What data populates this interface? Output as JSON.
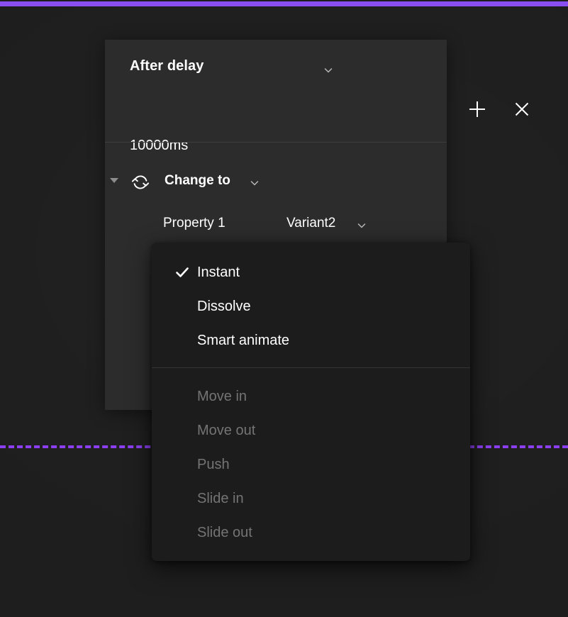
{
  "canvas": {
    "background_color": "#1e1e1e",
    "accent_color": "#8b4ef0",
    "top_bar_name": "top-accent-bar",
    "guide_name": "dashed-guide"
  },
  "panel": {
    "trigger": {
      "label": "After delay",
      "chevron_icon": "chevron-down-icon"
    },
    "header_actions": {
      "add_icon": "plus-icon",
      "close_icon": "close-icon"
    },
    "delay": {
      "value": "10000ms"
    },
    "action": {
      "disclosure_icon": "triangle-down-icon",
      "type_icon": "swap-sync-icon",
      "label": "Change to",
      "chevron_icon": "chevron-down-icon"
    },
    "property": {
      "name": "Property 1",
      "value": "Variant2",
      "chevron_icon": "chevron-down-icon"
    }
  },
  "menu": {
    "checked_icon": "check-icon",
    "groups": [
      {
        "items": [
          {
            "label": "Instant",
            "checked": true,
            "disabled": false
          },
          {
            "label": "Dissolve",
            "checked": false,
            "disabled": false
          },
          {
            "label": "Smart animate",
            "checked": false,
            "disabled": false
          }
        ]
      },
      {
        "items": [
          {
            "label": "Move in",
            "checked": false,
            "disabled": true
          },
          {
            "label": "Move out",
            "checked": false,
            "disabled": true
          },
          {
            "label": "Push",
            "checked": false,
            "disabled": true
          },
          {
            "label": "Slide in",
            "checked": false,
            "disabled": true
          },
          {
            "label": "Slide out",
            "checked": false,
            "disabled": true
          }
        ]
      }
    ]
  }
}
